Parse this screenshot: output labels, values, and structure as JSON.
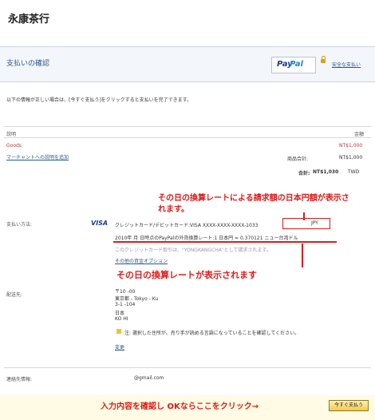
{
  "header": {
    "store_name": "永康茶行",
    "page_title": "支払いの確認",
    "paypal_logo_part1": "Pay",
    "paypal_logo_part2": "Pal",
    "safe_link": "安全な支払い",
    "instruction": "以下の情報が正しい場合は、[今すぐ支払う]をクリックすると支払いを完了できます。"
  },
  "summary": {
    "col_description": "説明",
    "col_amount": "金額",
    "item_name": "Goods",
    "item_amount": "NT$1,000",
    "add_merchant_note": "マーチャントへの説明を追加",
    "subtotal_label": "商品合計:",
    "subtotal_value": "NT$1,000",
    "total_label": "合計:",
    "total_value": "NT$1,030",
    "currency": "TWD"
  },
  "payment": {
    "label": "支払い方法:",
    "card_brand": "VISA",
    "card_line": "クレジットカード/デビットカード:VISA XXXX-XXXX-XXXX-1033",
    "jpy_amount": "JPY",
    "exchange_rate": "2010年 月 日時点のPayPalの外貨換算レート:1 日本円 = 0.370121 ニュー台湾ドル",
    "charge_note": "このクレジットカード取引は、\"YONGKANGCHA\"として請求されます。",
    "other_funding_link": "その他の資金オプション"
  },
  "annotations": {
    "top": "その日の換算レートによる請求額の日本円額が表示されます。",
    "middle": "その日の換算レートが表示されます",
    "bottom": "入力内容を確認し OKならここをクリック→"
  },
  "shipping": {
    "label": "配送先:",
    "postal": "〒10 -00",
    "line1": "東京都 - Tokyo - Ku",
    "line2": "3-1 -104",
    "country": "日本",
    "name": "KO HI",
    "note": "注: 選択した住所が、売り手が読める言語になっていることを確認してください。",
    "change_link": "変更"
  },
  "contact": {
    "label": "連絡先情報:",
    "email": "@gmail.com"
  },
  "button": {
    "pay_now": "今すぐ支払う"
  },
  "colors": {
    "accent_red": "#e01a1a",
    "link_blue": "#2c5a8c",
    "paypal_dark": "#1a3c8c",
    "paypal_light": "#1f86c8"
  }
}
